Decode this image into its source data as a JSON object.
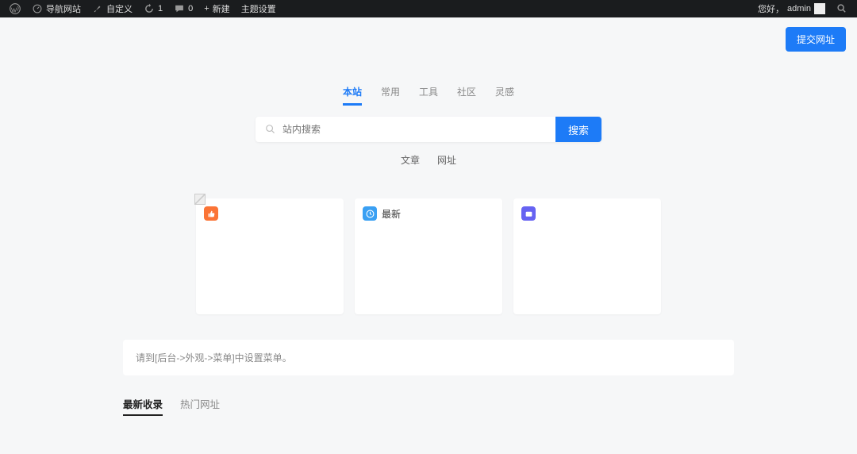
{
  "adminBar": {
    "items": [
      {
        "label": "导航网站"
      },
      {
        "label": "自定义"
      },
      {
        "label": "1"
      },
      {
        "label": "0"
      },
      {
        "label": "新建",
        "prefix": "+"
      },
      {
        "label": "主题设置"
      }
    ],
    "greeting": "您好，",
    "username": "admin"
  },
  "topAction": {
    "label": "提交网址"
  },
  "engineTabs": [
    "本站",
    "常用",
    "工具",
    "社区",
    "灵感"
  ],
  "engineActiveIndex": 0,
  "search": {
    "placeholder": "站内搜索",
    "button": "搜索"
  },
  "subTabs": [
    "文章",
    "网址"
  ],
  "cards": [
    {
      "title": "",
      "iconClass": "icon-orange"
    },
    {
      "title": "最新",
      "iconClass": "icon-blue"
    },
    {
      "title": "",
      "iconClass": "icon-purple",
      "watermark": ""
    }
  ],
  "notice": "请到[后台->外观->菜单]中设置菜单。",
  "sectionTabs": [
    "最新收录",
    "热门网址"
  ],
  "sectionActiveIndex": 0
}
